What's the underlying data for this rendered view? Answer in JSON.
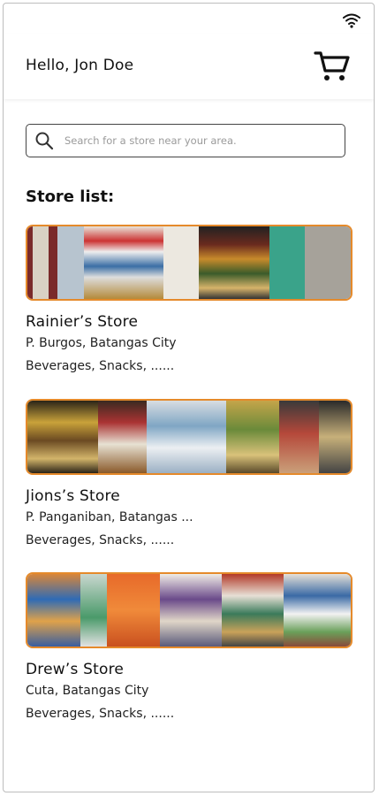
{
  "header": {
    "greeting": "Hello, Jon Doe",
    "cart_icon": "shopping-cart-icon"
  },
  "status": {
    "wifi_icon": "wifi-icon"
  },
  "search": {
    "placeholder": "Search for a store near your area.",
    "icon": "search-icon"
  },
  "store_list": {
    "title": "Store list:",
    "stores": [
      {
        "name": "Rainier’s Store",
        "address": "P. Burgos, Batangas City",
        "categories": "Beverages, Snacks, ......"
      },
      {
        "name": "Jions’s Store",
        "address": "P. Panganiban, Batangas ...",
        "categories": "Beverages, Snacks, ......"
      },
      {
        "name": "Drew’s Store",
        "address": "Cuta, Batangas City",
        "categories": "Beverages, Snacks, ......"
      }
    ]
  },
  "colors": {
    "accent_border": "#e58a2b",
    "text": "#111111",
    "placeholder": "#9a9a9a"
  }
}
